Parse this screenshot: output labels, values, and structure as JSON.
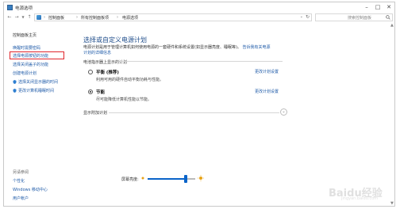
{
  "window": {
    "title": "电源选项"
  },
  "address": {
    "breadcrumbs": [
      "控制面板",
      "所有控制面板项",
      "电源选项"
    ],
    "search_placeholder": "搜索控制面板"
  },
  "sidebar": {
    "home": "控制面板主页",
    "items": [
      "唤醒时需要密码",
      "选择电源按钮的功能",
      "选择关闭盖子的功能",
      "创建电源计划",
      "选择关闭显示器的时间",
      "更改计算机睡眠时间"
    ],
    "see_also_label": "另请参阅",
    "see_also_items": [
      "个性化",
      "Windows 移动中心",
      "用户帐户"
    ]
  },
  "main": {
    "title": "选择或自定义电源计划",
    "description": "电源计划是用于管理计算机如何使用电源的一套硬件和系统设置(如显示器亮度、睡眠等)。",
    "description_link": "告诉我有关电源计划的详细信息",
    "section_label": "电池指示器上显示的计划",
    "plans": [
      {
        "name": "平衡 (推荐)",
        "desc": "利用可用的硬件自动平衡功耗与性能。",
        "change": "更改计划设置",
        "selected": false
      },
      {
        "name": "节能",
        "desc": "尽可能降低计算机性能以节能。",
        "change": "更改计划设置",
        "selected": true
      }
    ],
    "more_plans": "显示附加计划"
  },
  "brightness": {
    "label": "屏幕亮度:",
    "level": 0.8
  },
  "watermark": {
    "text": "Baidu经验",
    "sub": "jingyan.baidu.com"
  },
  "colors": {
    "link": "#1e5aa8",
    "title": "#1e4c8a",
    "highlight": "#e0262c",
    "accent": "#0a64c9"
  }
}
